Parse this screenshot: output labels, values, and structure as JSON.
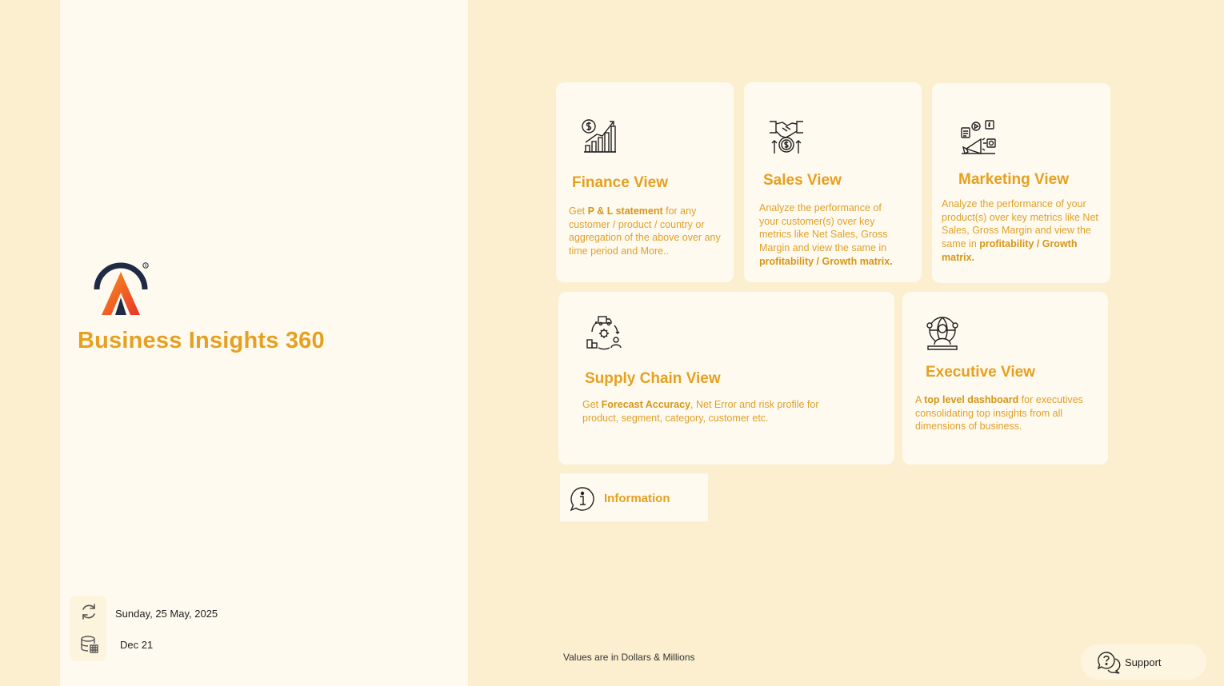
{
  "app": {
    "title": "Business Insights 360",
    "logo_icon": "atliq-logo-icon"
  },
  "status": {
    "refresh_date": "Sunday, 25 May, 2025",
    "data_period": "Dec 21"
  },
  "cards": {
    "finance": {
      "title": "Finance View",
      "desc": [
        {
          "t": "Get  ",
          "b": false
        },
        {
          "t": "P & L statement",
          "b": true
        },
        {
          "t": " for any customer / product / country or aggregation of the above over any time period and More..",
          "b": false
        }
      ]
    },
    "sales": {
      "title": "Sales View",
      "desc": [
        {
          "t": "Analyze the performance of your customer(s) over key metrics like Net Sales, Gross Margin and view the same in ",
          "b": false
        },
        {
          "t": "profitability / Growth matrix.",
          "b": true
        }
      ]
    },
    "marketing": {
      "title": "Marketing View",
      "desc": [
        {
          "t": "Analyze the performance of your product(s) over key metrics like Net Sales, Gross Margin and view the same in ",
          "b": false
        },
        {
          "t": "profitability / Growth matrix.",
          "b": true
        }
      ]
    },
    "supply_chain": {
      "title": "Supply Chain View",
      "desc": [
        {
          "t": "Get ",
          "b": false
        },
        {
          "t": "Forecast Accuracy",
          "b": true
        },
        {
          "t": ", Net Error and risk profile for product, segment, category, customer etc.",
          "b": false
        }
      ]
    },
    "executive": {
      "title": "Executive View",
      "desc": [
        {
          "t": "A ",
          "b": false
        },
        {
          "t": "top level dashboard",
          "b": true
        },
        {
          "t": " for executives consolidating top insights from all dimensions of business.",
          "b": false
        }
      ]
    }
  },
  "info_button": {
    "label": "Information"
  },
  "footnote": "Values are in Dollars & Millions",
  "support_button": {
    "label": "Support"
  },
  "colors": {
    "accent": "#e6a020",
    "background": "#fbefcf",
    "panel": "#fefaf0",
    "logo_orange": "#f0542e",
    "logo_navy": "#1f2a44"
  }
}
